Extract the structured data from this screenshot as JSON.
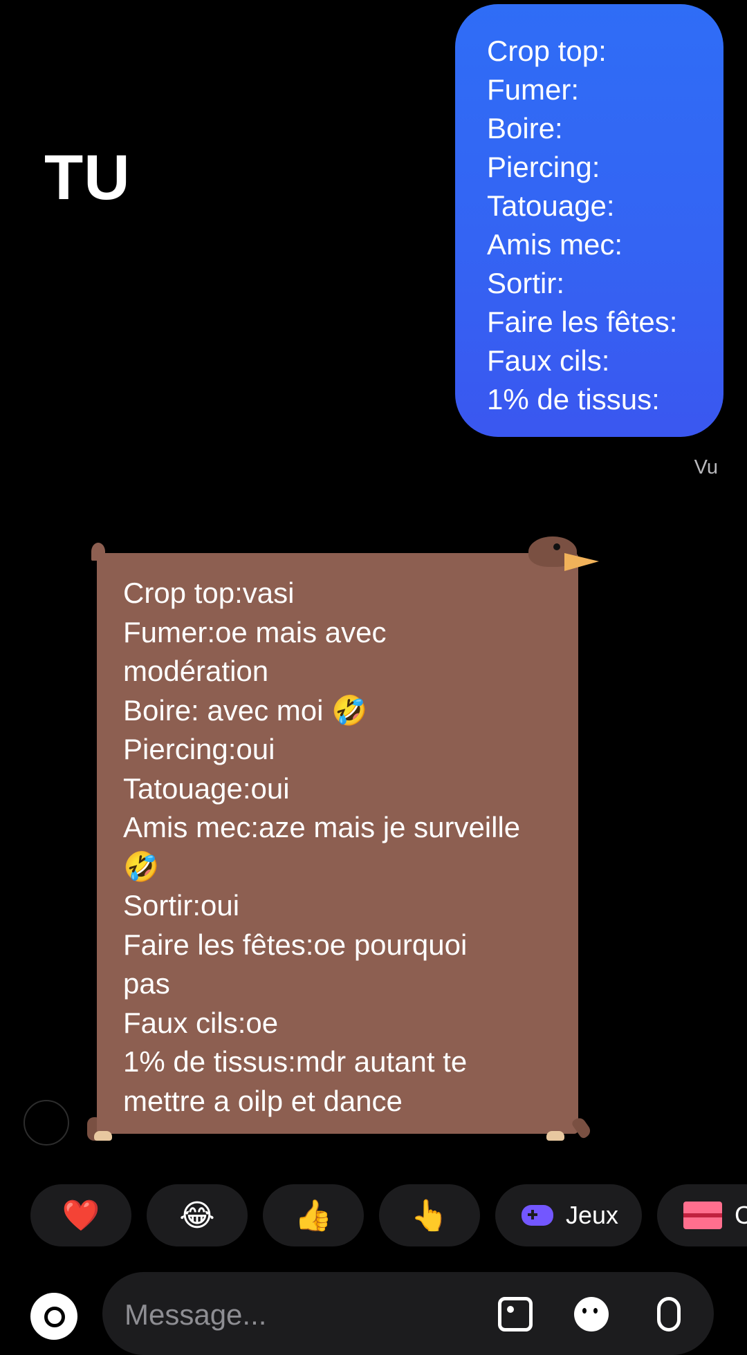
{
  "overlay": {
    "title": "TU"
  },
  "sent_message": {
    "lines": [
      "Crop top:",
      "Fumer:",
      "Boire:",
      "Piercing:",
      "Tatouage:",
      "Amis mec:",
      "Sortir:",
      "Faire les fêtes:",
      "Faux cils:",
      "1% de tissus:"
    ],
    "status": "Vu",
    "color_top": "#2f6df6",
    "color_bottom": "#3a57f0"
  },
  "received_message": {
    "bubble_color": "#8d5f51",
    "lines": [
      "Crop top:vasi",
      "Fumer:oe mais avec",
      "modération",
      "Boire: avec moi 🤣",
      "Piercing:oui",
      "Tatouage:oui",
      "Amis mec:aze mais je surveille",
      "🤣",
      "Sortir:oui",
      "Faire les fêtes:oe pourquoi",
      "pas",
      "Faux cils:oe",
      "1% de tissus:mdr autant te",
      "mettre a oilp et dance"
    ]
  },
  "quick_reactions": [
    {
      "name": "heart",
      "emoji": "❤️"
    },
    {
      "name": "laughing",
      "emoji": "😂"
    },
    {
      "name": "thumbs-up",
      "emoji": "👍"
    },
    {
      "name": "pointing-hand",
      "emoji": "👆"
    }
  ],
  "quick_actions": {
    "games_label": "Jeux",
    "gift_label": "C"
  },
  "composer": {
    "placeholder": "Message..."
  }
}
